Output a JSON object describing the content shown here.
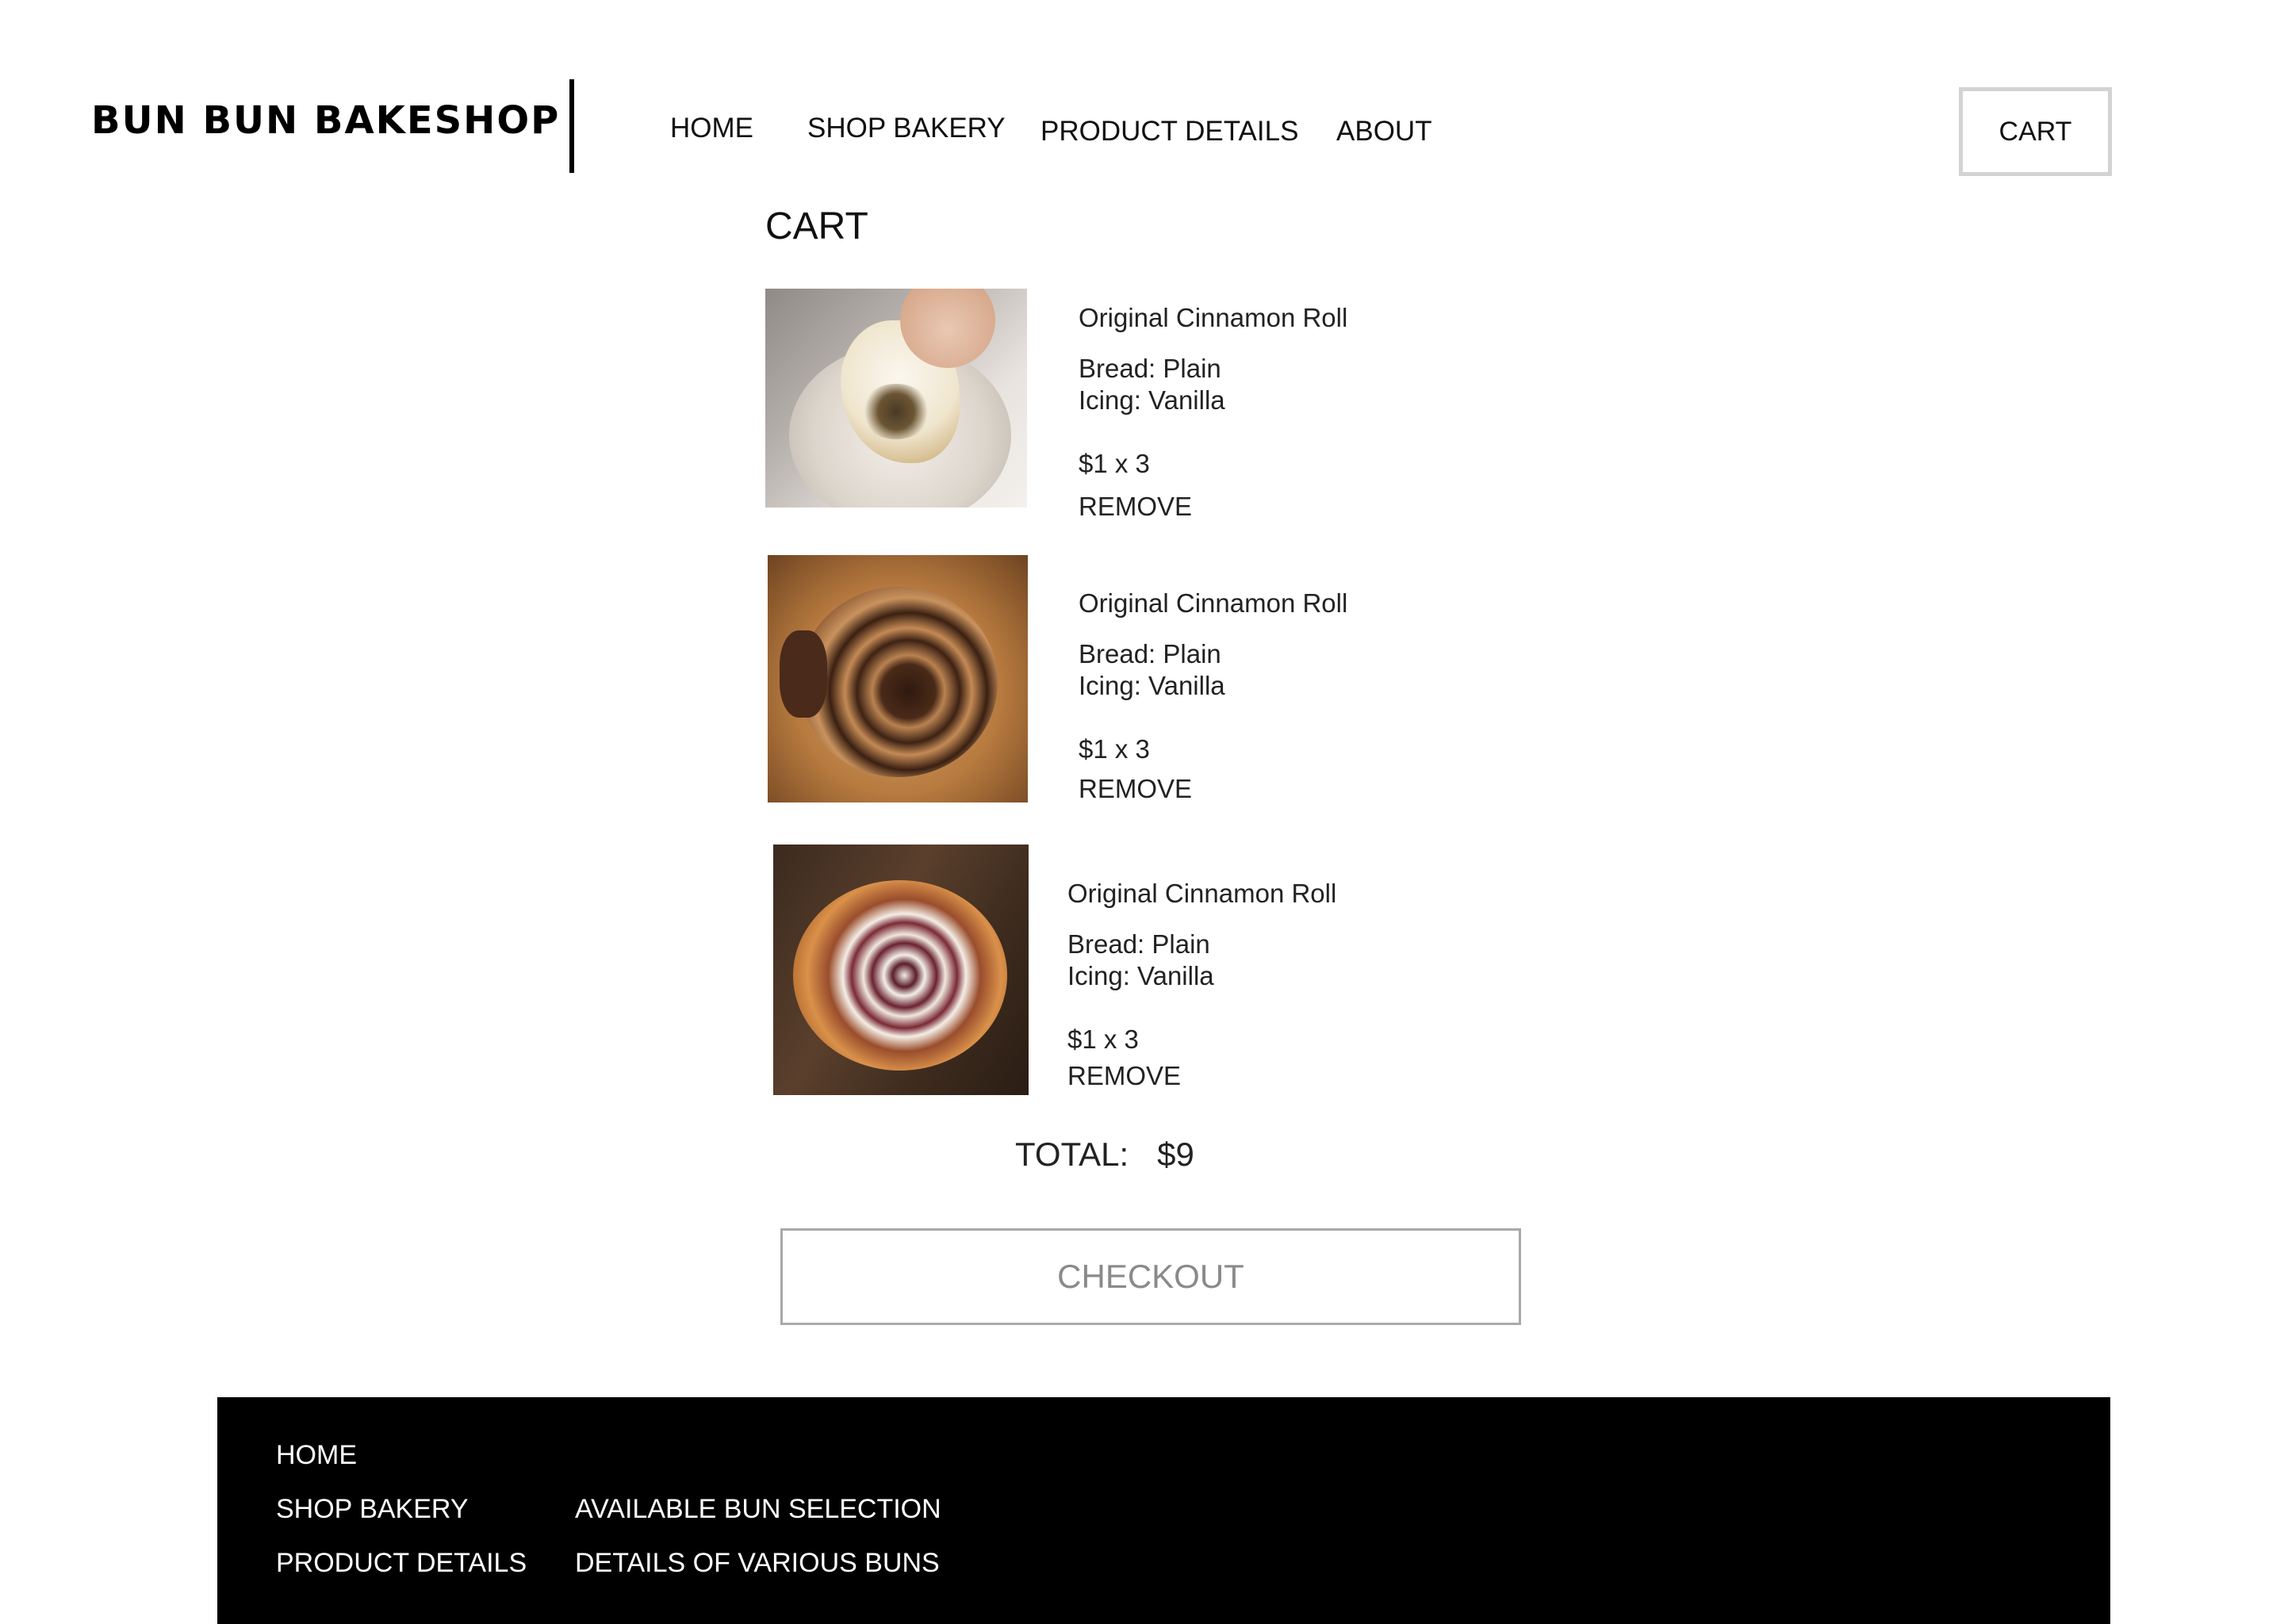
{
  "header": {
    "brand": "BUN BUN BAKESHOP",
    "nav": {
      "home": "HOME",
      "shop": "SHOP BAKERY",
      "product": "PRODUCT DETAILS",
      "about": "ABOUT"
    },
    "cart_button": "CART"
  },
  "cart": {
    "title": "CART",
    "items": [
      {
        "name": "Original Cinnamon Roll",
        "bread": "Bread: Plain",
        "icing": "Icing: Vanilla",
        "price_qty": "$1 x 3",
        "remove": "REMOVE",
        "image": "cinnamon-roll-vanilla-icing-photo"
      },
      {
        "name": "Original Cinnamon Roll",
        "bread": "Bread: Plain",
        "icing": "Icing: Vanilla",
        "price_qty": "$1 x 3",
        "remove": "REMOVE",
        "image": "chocolate-cinnamon-roll-photo"
      },
      {
        "name": "Original Cinnamon Roll",
        "bread": "Bread: Plain",
        "icing": "Icing: Vanilla",
        "price_qty": "$1 x 3",
        "remove": "REMOVE",
        "image": "berry-cinnamon-roll-photo"
      }
    ],
    "total_label": "TOTAL:",
    "total_value": "$9",
    "checkout": "CHECKOUT"
  },
  "footer": {
    "home": "HOME",
    "shop": "SHOP BAKERY",
    "product": "PRODUCT DETAILS",
    "available": "AVAILABLE BUN SELECTION",
    "details": "DETAILS OF VARIOUS BUNS"
  },
  "colors": {
    "background": "#ffffff",
    "text": "#111111",
    "footer_bg": "#000000",
    "footer_text": "#ffffff",
    "cart_button_border": "#d3d3d3",
    "checkout_border": "#a9a9a9",
    "checkout_text": "#8a8a8a"
  }
}
